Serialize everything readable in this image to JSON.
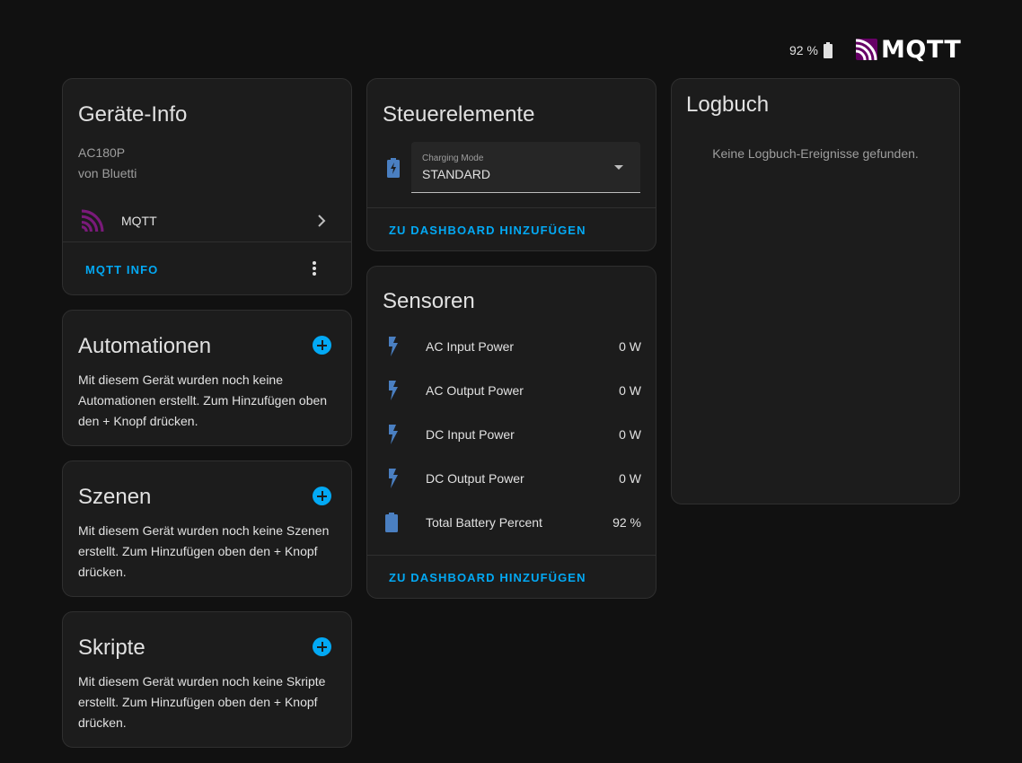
{
  "header": {
    "battery_text": "92 %",
    "brand_text": "MQTT"
  },
  "colors": {
    "accent": "#03a9f4",
    "icon_blue": "#4a7fc1",
    "mqtt_purple": "#660066",
    "background": "#111111",
    "card": "#1c1c1c"
  },
  "device_info": {
    "title": "Geräte-Info",
    "model": "AC180P",
    "manufacturer": "von Bluetti",
    "integration_label": "MQTT",
    "action_label": "MQTT INFO"
  },
  "automations": {
    "title": "Automationen",
    "text": "Mit diesem Gerät wurden noch keine Automationen erstellt. Zum Hinzufügen oben den + Knopf drücken."
  },
  "scenes": {
    "title": "Szenen",
    "text": "Mit diesem Gerät wurden noch keine Szenen erstellt. Zum Hinzufügen oben den + Knopf drücken."
  },
  "scripts": {
    "title": "Skripte",
    "text": "Mit diesem Gerät wurden noch keine Skripte erstellt. Zum Hinzufügen oben den + Knopf drücken."
  },
  "controls": {
    "title": "Steuerelemente",
    "select_label": "Charging Mode",
    "select_value": "STANDARD",
    "icon": "battery-charging-icon",
    "action_label": "ZU DASHBOARD HINZUFÜGEN"
  },
  "sensors": {
    "title": "Sensoren",
    "items": [
      {
        "icon": "flash-icon",
        "name": "AC Input Power",
        "value": "0 W"
      },
      {
        "icon": "flash-icon",
        "name": "AC Output Power",
        "value": "0 W"
      },
      {
        "icon": "flash-icon",
        "name": "DC Input Power",
        "value": "0 W"
      },
      {
        "icon": "flash-icon",
        "name": "DC Output Power",
        "value": "0 W"
      },
      {
        "icon": "battery-icon",
        "name": "Total Battery Percent",
        "value": "92 %"
      }
    ],
    "action_label": "ZU DASHBOARD HINZUFÜGEN"
  },
  "logbook": {
    "title": "Logbuch",
    "empty_text": "Keine Logbuch-Ereignisse gefunden."
  }
}
